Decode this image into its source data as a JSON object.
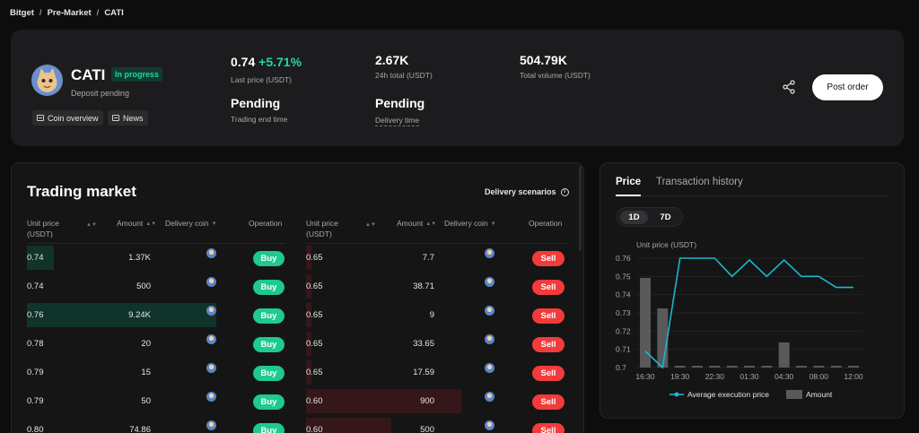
{
  "breadcrumb": [
    "Bitget",
    "Pre-Market",
    "CATI"
  ],
  "coin": {
    "name": "CATI",
    "badge": "In progress",
    "status": "Deposit pending",
    "chips": [
      "Coin overview",
      "News"
    ]
  },
  "stats": [
    {
      "value": "0.74",
      "change": "+5.71%",
      "label": "Last price (USDT)"
    },
    {
      "value": "2.67K",
      "label": "24h total (USDT)"
    },
    {
      "value": "504.79K",
      "label": "Total volume (USDT)"
    },
    {
      "value": "Pending",
      "label": "Trading end time"
    },
    {
      "value": "Pending",
      "label": "Delivery time"
    }
  ],
  "actions": {
    "post_order": "Post order",
    "share_icon": "share-icon"
  },
  "market": {
    "title": "Trading market",
    "delivery_link": "Delivery scenarios",
    "columns": {
      "unit_price": "Unit price\n(USDT)",
      "amount": "Amount",
      "delivery_coin": "Delivery coin",
      "operation": "Operation"
    },
    "buy_label": "Buy",
    "sell_label": "Sell",
    "buy_orders": [
      {
        "price": "0.74",
        "amount": "1.37K",
        "depth": 0.14
      },
      {
        "price": "0.74",
        "amount": "500",
        "depth": 0.0
      },
      {
        "price": "0.76",
        "amount": "9.24K",
        "depth": 1.0
      },
      {
        "price": "0.78",
        "amount": "20",
        "depth": 0.0
      },
      {
        "price": "0.79",
        "amount": "15",
        "depth": 0.0
      },
      {
        "price": "0.79",
        "amount": "50",
        "depth": 0.0
      },
      {
        "price": "0.80",
        "amount": "74.86",
        "depth": 0.0
      }
    ],
    "sell_orders": [
      {
        "price": "0.65",
        "amount": "7.7",
        "depth": 0.03
      },
      {
        "price": "0.65",
        "amount": "38.71",
        "depth": 0.03
      },
      {
        "price": "0.65",
        "amount": "9",
        "depth": 0.03
      },
      {
        "price": "0.65",
        "amount": "33.65",
        "depth": 0.03
      },
      {
        "price": "0.65",
        "amount": "17.59",
        "depth": 0.03
      },
      {
        "price": "0.60",
        "amount": "900",
        "depth": 0.82
      },
      {
        "price": "0.60",
        "amount": "500",
        "depth": 0.45
      }
    ]
  },
  "chart_panel": {
    "tabs": [
      "Price",
      "Transaction history"
    ],
    "active_tab": "Price",
    "ranges": [
      "1D",
      "7D"
    ],
    "active_range": "1D"
  },
  "chart_data": {
    "type": "line",
    "ylabel": "Unit price (USDT)",
    "ylim": [
      0.7,
      0.76
    ],
    "yticks": [
      "0.76",
      "0.75",
      "0.74",
      "0.73",
      "0.72",
      "0.71",
      "0.7"
    ],
    "xticks": [
      "16:30",
      "19:30",
      "22:30",
      "01:30",
      "04:30",
      "08:00",
      "12:00"
    ],
    "x": [
      "16:30",
      "18:00",
      "19:30",
      "21:00",
      "22:30",
      "24:00",
      "01:30",
      "03:00",
      "04:30",
      "06:00",
      "08:00",
      "10:00",
      "12:00"
    ],
    "series": [
      {
        "name": "Average execution price",
        "type": "line",
        "color": "#1bb6d2",
        "values": [
          0.709,
          0.7,
          0.76,
          0.76,
          0.76,
          0.75,
          0.759,
          0.75,
          0.759,
          0.75,
          0.75,
          0.744,
          0.744
        ]
      },
      {
        "name": "Amount",
        "type": "bar",
        "color": "#595959",
        "values": [
          0.05,
          0.033,
          0.001,
          0.001,
          0.001,
          0.001,
          0.001,
          0.001,
          0.014,
          0.001,
          0.001,
          0.001,
          0.001
        ]
      }
    ],
    "legend": "bottom"
  }
}
